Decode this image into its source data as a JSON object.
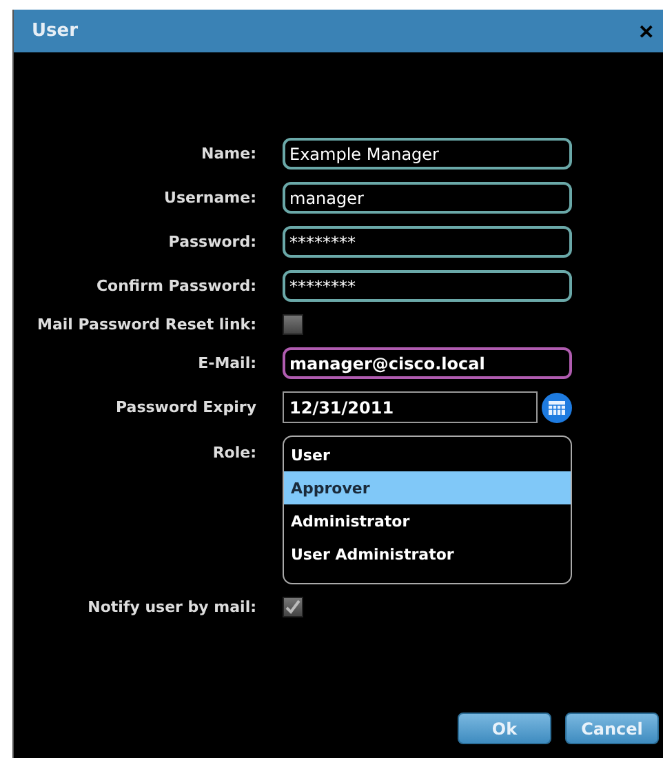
{
  "window": {
    "title": "User",
    "close": "✕"
  },
  "fields": [
    {
      "kind": "text",
      "label": "Name:",
      "value": "Example Manager",
      "focused": false
    },
    {
      "kind": "text",
      "label": "Username:",
      "value": "manager",
      "focused": false
    },
    {
      "kind": "text",
      "label": "Password:",
      "value": "********",
      "focused": false
    },
    {
      "kind": "text",
      "label": "Confirm Password:",
      "value": "********",
      "focused": false
    },
    {
      "kind": "checkbox",
      "label": "Mail Password Reset link:",
      "checked": false
    },
    {
      "kind": "text",
      "label": "E-Mail:",
      "value": "manager@cisco.local",
      "focused": true
    },
    {
      "kind": "date",
      "label": "Password Expiry",
      "value": "12/31/2011"
    },
    {
      "kind": "list",
      "label": "Role:",
      "options": [
        {
          "label": "User",
          "selected": false
        },
        {
          "label": "Approver",
          "selected": true
        },
        {
          "label": "Administrator",
          "selected": false
        },
        {
          "label": "User Administrator",
          "selected": false
        }
      ]
    },
    {
      "kind": "checkbox",
      "label": "Notify user by mail:",
      "checked": true
    }
  ],
  "buttons": [
    "Ok",
    "Cancel"
  ]
}
